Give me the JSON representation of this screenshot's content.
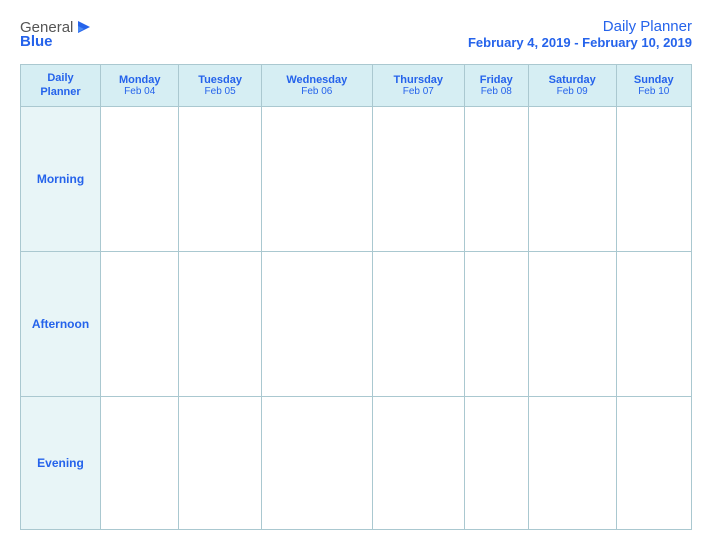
{
  "header": {
    "logo": {
      "general": "General",
      "blue": "Blue",
      "icon": "▶"
    },
    "title": "Daily Planner",
    "subtitle": "February 4, 2019 - February 10, 2019"
  },
  "table": {
    "label_col": {
      "top": "Daily",
      "bottom": "Planner"
    },
    "days": [
      {
        "name": "Monday",
        "date": "Feb 04"
      },
      {
        "name": "Tuesday",
        "date": "Feb 05"
      },
      {
        "name": "Wednesday",
        "date": "Feb 06"
      },
      {
        "name": "Thursday",
        "date": "Feb 07"
      },
      {
        "name": "Friday",
        "date": "Feb 08"
      },
      {
        "name": "Saturday",
        "date": "Feb 09"
      },
      {
        "name": "Sunday",
        "date": "Feb 10"
      }
    ],
    "rows": [
      {
        "label": "Morning"
      },
      {
        "label": "Afternoon"
      },
      {
        "label": "Evening"
      }
    ]
  }
}
